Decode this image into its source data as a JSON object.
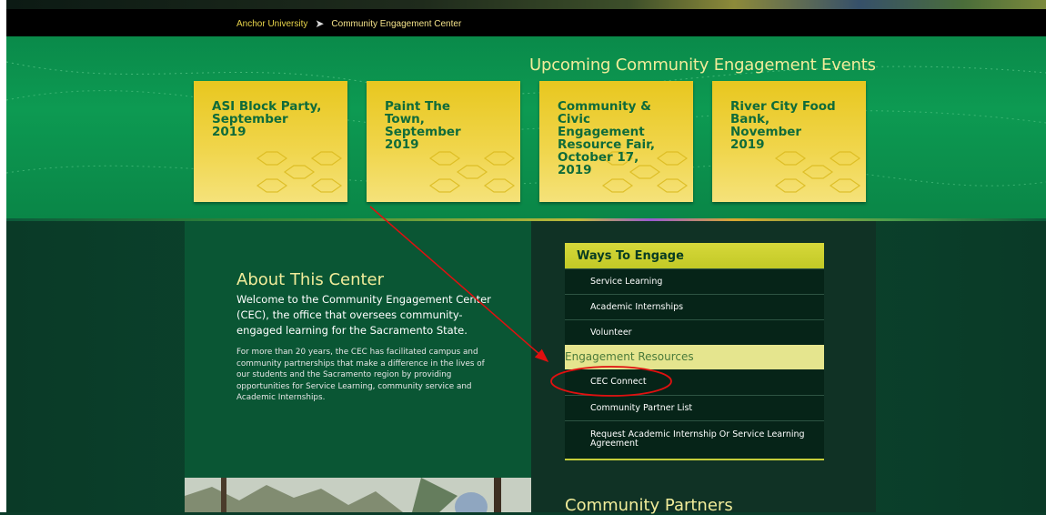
{
  "breadcrumb": {
    "home": "Anchor University",
    "current": "Community Engagement Center"
  },
  "events": {
    "title": "Upcoming Community Engagement Events",
    "cards": [
      {
        "lines": [
          "ASI Block Party,",
          "September",
          "2019"
        ]
      },
      {
        "lines": [
          "Paint The",
          "Town,",
          "September",
          "2019"
        ]
      },
      {
        "lines": [
          "Community &",
          "Civic",
          "Engagement",
          "Resource Fair,",
          "October 17,",
          "2019"
        ]
      },
      {
        "lines": [
          "River City Food",
          "Bank,",
          "November",
          "2019"
        ]
      }
    ]
  },
  "about": {
    "title": "About This Center",
    "intro": "Welcome to the Community Engagement Center (CEC), the office that oversees community-engaged learning for the Sacramento State.",
    "body": "For more than 20 years, the CEC has facilitated campus and community partnerships that make a difference in the lives of our students and the Sacramento region by providing opportunities for Service Learning, community service and Academic Internships."
  },
  "ways": {
    "header": "Ways To Engage",
    "items": [
      "Service Learning",
      "Academic Internships",
      "Volunteer"
    ],
    "resources_header": "Engagement Resources",
    "resources": [
      "CEC Connect",
      "Community Partner List",
      "Request Academic Internship Or Service Learning Agreement"
    ]
  },
  "partners": {
    "title": "Community Partners"
  },
  "colors": {
    "accent_yellow": "#f1ec9a",
    "card_yellow": "#f0d54a",
    "green_band": "#0d9a52",
    "annotation_red": "#e01010"
  }
}
